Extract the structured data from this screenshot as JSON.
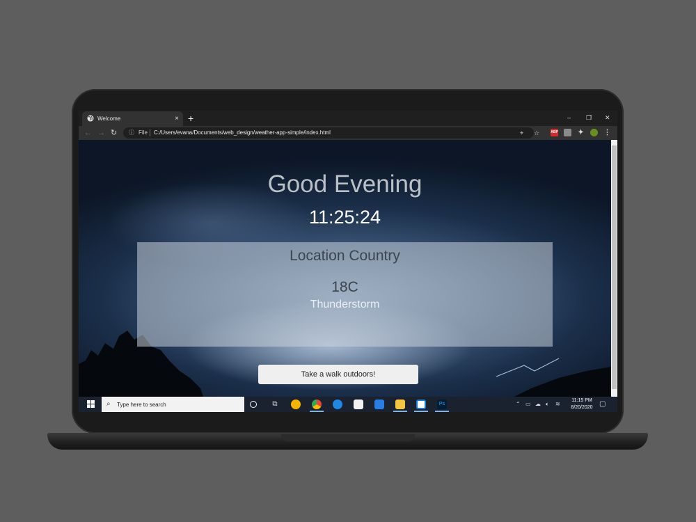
{
  "browser": {
    "tab_title": "Welcome",
    "tab_close": "×",
    "new_tab": "+",
    "minimize": "–",
    "restore": "❐",
    "close": "✕",
    "back": "←",
    "forward": "→",
    "reload": "↻",
    "scheme_label": "File",
    "url": "C:/Users/evana/Documents/web_design/weather-app-simple/index.html",
    "extensions": [
      {
        "name": "adblock-plus-icon",
        "label": "ABP",
        "color": "#d62b2b"
      },
      {
        "name": "extension-gray-icon",
        "label": "",
        "color": "#8a8a8a"
      },
      {
        "name": "extension-puzzle-icon",
        "label": "",
        "color": "#444"
      }
    ]
  },
  "page": {
    "greeting": "Good Evening",
    "time": "11:25:24",
    "location": "Location  Country",
    "temperature": "18C",
    "condition": "Thunderstorm",
    "suggestion_button": "Take a walk outdoors!"
  },
  "taskbar": {
    "search_placeholder": "Type here to search",
    "apps": [
      {
        "name": "cortana-icon"
      },
      {
        "name": "task-view-icon"
      },
      {
        "name": "chrome-canary-icon",
        "color": "#f4b400"
      },
      {
        "name": "chrome-icon",
        "color": "#34a853"
      },
      {
        "name": "edge-icon",
        "color": "#1e88e5"
      },
      {
        "name": "store-icon",
        "color": "#ffffff"
      },
      {
        "name": "mail-icon",
        "color": "#2a7de1"
      },
      {
        "name": "file-explorer-icon",
        "color": "#f5c542"
      },
      {
        "name": "sandbox-app-icon",
        "color": "#1b7bd1"
      },
      {
        "name": "photoshop-icon",
        "label": "Ps",
        "color": "#001e36"
      }
    ],
    "clock_time": "11:15 PM",
    "clock_date": "8/20/2020"
  },
  "colors": {
    "accent": "#7fb4e8",
    "card": "rgba(200,208,218,0.55)",
    "background": "#5e5e5e"
  }
}
